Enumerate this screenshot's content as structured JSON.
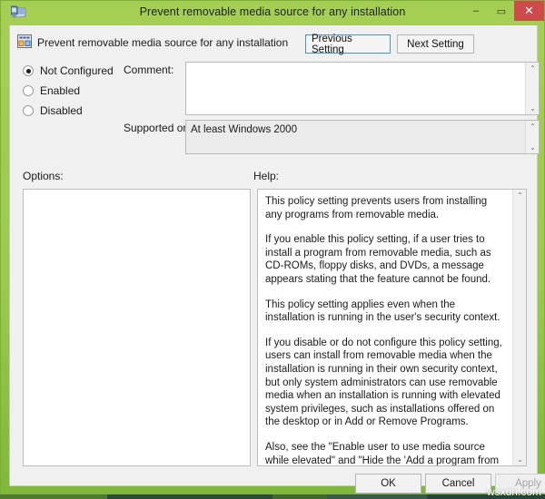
{
  "window": {
    "title": "Prevent removable media source for any installation",
    "app_icon": "policy-editor-icon",
    "minimize_glyph": "–",
    "maximize_glyph": "▭",
    "close_glyph": "✕"
  },
  "header": {
    "policy_icon": "policy-setting-icon",
    "policy_name": "Prevent removable media source for any installation",
    "previous_button": "Previous Setting",
    "next_button": "Next Setting"
  },
  "config": {
    "options": [
      {
        "label": "Not Configured",
        "selected": true
      },
      {
        "label": "Enabled",
        "selected": false
      },
      {
        "label": "Disabled",
        "selected": false
      }
    ],
    "comment_label": "Comment:",
    "comment_value": "",
    "supported_label": "Supported on:",
    "supported_value": "At least Windows 2000",
    "scroll_up_glyph": "⌃",
    "scroll_down_glyph": "⌄"
  },
  "panels": {
    "options_label": "Options:",
    "options_content": "",
    "help_label": "Help:",
    "help_paragraphs": [
      "This policy setting prevents users from installing any programs from removable media.",
      "If you enable this policy setting, if a user tries to install a program from removable media, such as CD-ROMs, floppy disks, and DVDs, a message appears stating that the feature cannot be found.",
      "This policy setting applies even when the installation is running in the user's security context.",
      "If you disable or do not configure this policy setting, users can install from removable media when the installation is running in their own security context, but only system administrators can use removable media when an installation is running with elevated system privileges, such as installations offered on the desktop or in Add or Remove Programs.",
      "Also, see the \"Enable user to use media source while elevated\" and \"Hide the 'Add a program from CD-ROM or floppy disk' option\" policy settings."
    ]
  },
  "footer": {
    "ok": "OK",
    "cancel": "Cancel",
    "apply": "Apply"
  },
  "watermark": "wsxdn.com",
  "colors": {
    "window_frame_green": "#9ccb4c",
    "close_button_red": "#cf4a4a",
    "focus_border_blue": "#3c93d6",
    "client_background": "#f0f0f0"
  }
}
